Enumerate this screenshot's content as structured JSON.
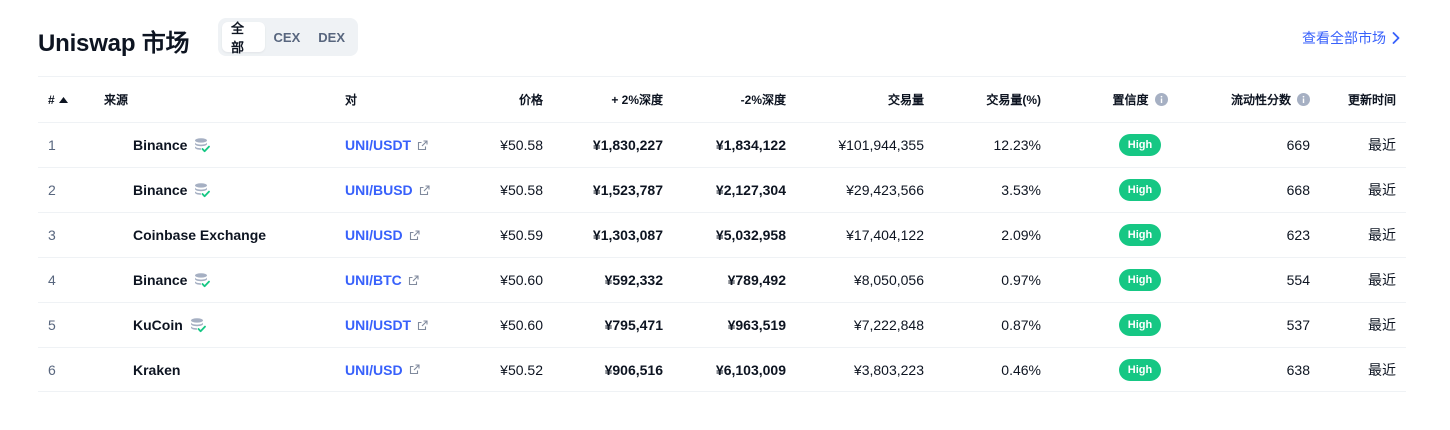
{
  "header": {
    "title": "Uniswap 市场",
    "tabs": [
      {
        "label": "全部",
        "active": true
      },
      {
        "label": "CEX",
        "active": false
      },
      {
        "label": "DEX",
        "active": false
      }
    ],
    "view_all": "查看全部市场"
  },
  "table": {
    "columns": [
      "#",
      "来源",
      "对",
      "价格",
      "+ 2%深度",
      "-2%深度",
      "交易量",
      "交易量(%)",
      "置信度",
      "流动性分数",
      "更新时间"
    ],
    "rows": [
      {
        "rank": "1",
        "source": "Binance",
        "verified": true,
        "pair": "UNI/USDT",
        "price": "¥50.58",
        "depth_plus": "¥1,830,227",
        "depth_minus": "¥1,834,122",
        "volume": "¥101,944,355",
        "volume_pct": "12.23%",
        "confidence": "High",
        "liquidity": "669",
        "updated": "最近"
      },
      {
        "rank": "2",
        "source": "Binance",
        "verified": true,
        "pair": "UNI/BUSD",
        "price": "¥50.58",
        "depth_plus": "¥1,523,787",
        "depth_minus": "¥2,127,304",
        "volume": "¥29,423,566",
        "volume_pct": "3.53%",
        "confidence": "High",
        "liquidity": "668",
        "updated": "最近"
      },
      {
        "rank": "3",
        "source": "Coinbase Exchange",
        "verified": false,
        "pair": "UNI/USD",
        "price": "¥50.59",
        "depth_plus": "¥1,303,087",
        "depth_minus": "¥5,032,958",
        "volume": "¥17,404,122",
        "volume_pct": "2.09%",
        "confidence": "High",
        "liquidity": "623",
        "updated": "最近"
      },
      {
        "rank": "4",
        "source": "Binance",
        "verified": true,
        "pair": "UNI/BTC",
        "price": "¥50.60",
        "depth_plus": "¥592,332",
        "depth_minus": "¥789,492",
        "volume": "¥8,050,056",
        "volume_pct": "0.97%",
        "confidence": "High",
        "liquidity": "554",
        "updated": "最近"
      },
      {
        "rank": "5",
        "source": "KuCoin",
        "verified": true,
        "pair": "UNI/USDT",
        "price": "¥50.60",
        "depth_plus": "¥795,471",
        "depth_minus": "¥963,519",
        "volume": "¥7,222,848",
        "volume_pct": "0.87%",
        "confidence": "High",
        "liquidity": "537",
        "updated": "最近"
      },
      {
        "rank": "6",
        "source": "Kraken",
        "verified": false,
        "pair": "UNI/USD",
        "price": "¥50.52",
        "depth_plus": "¥906,516",
        "depth_minus": "¥6,103,009",
        "volume": "¥3,803,223",
        "volume_pct": "0.46%",
        "confidence": "High",
        "liquidity": "638",
        "updated": "最近"
      }
    ]
  },
  "icons": {
    "sort": "sort-asc-icon",
    "verified": "verified-stack-icon",
    "external": "external-link-icon",
    "info": "info-icon",
    "chevron": "chevron-right-icon"
  },
  "colors": {
    "accent": "#3861fb",
    "confidence_high": "#16c784",
    "muted_text": "#58667e",
    "text": "#0d1421",
    "divider": "#eff2f5"
  }
}
